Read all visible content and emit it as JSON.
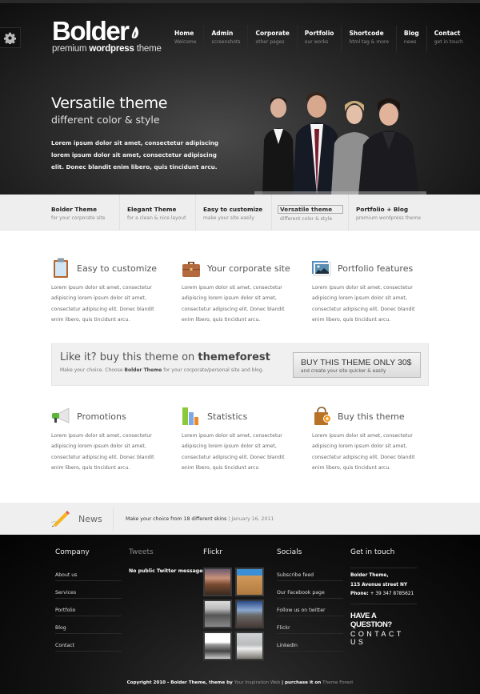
{
  "header": {
    "logo": "Bolder",
    "tagline_prefix": "premium",
    "tagline_bold": "wordpress",
    "tagline_suffix": "theme",
    "nav": [
      {
        "label": "Home",
        "sub": "Welcome"
      },
      {
        "label": "Admin",
        "sub": "screenshots"
      },
      {
        "label": "Corporate",
        "sub": "other pages"
      },
      {
        "label": "Portfolio",
        "sub": "our works"
      },
      {
        "label": "Shortcode",
        "sub": "html tag & more"
      },
      {
        "label": "Blog",
        "sub": "news"
      },
      {
        "label": "Contact",
        "sub": "get in touch"
      }
    ]
  },
  "hero": {
    "title": "Versatile theme",
    "subtitle": "different color & style",
    "text": "Lorem ipsum dolor sit amet, consectetur adipiscing lorem ipsum dolor sit amet, consectetur adipiscing elit. Donec blandit enim libero, quis tincidunt arcu."
  },
  "tabs": [
    {
      "label": "Bolder Theme",
      "sub": "for your corporate site"
    },
    {
      "label": "Elegant Theme",
      "sub": "for a clean & nice layout"
    },
    {
      "label": "Easy to customize",
      "sub": "make your site easily"
    },
    {
      "label": "Versatile theme",
      "sub": "different color & style",
      "active": true
    },
    {
      "label": "Portfolio + Blog",
      "sub": "premium wordpress theme"
    }
  ],
  "features": [
    {
      "icon": "clipboard-icon",
      "title": "Easy to customize",
      "text": "Lorem ipsum dolor sit amet, consectetur adipiscing lorem ipsum dolor sit amet, consectetur adipiscing elit. Donec blandit enim libero, quis tincidunt arcu."
    },
    {
      "icon": "briefcase-icon",
      "title": "Your corporate site",
      "text": "Lorem ipsum dolor sit amet, consectetur adipiscing lorem ipsum dolor sit amet, consectetur adipiscing elit. Donec blandit enim libero, quis tincidunt arcu."
    },
    {
      "icon": "picture-icon",
      "title": "Portfolio features",
      "text": "Lorem ipsum dolor sit amet, consectetur adipiscing lorem ipsum dolor sit amet, consectetur adipiscing elit. Donec blandit enim libero, quis tincidunt arcu."
    },
    {
      "icon": "megaphone-icon",
      "title": "Promotions",
      "text": "Lorem ipsum dolor sit amet, consectetur adipiscing lorem ipsum dolor sit amet, consectetur adipiscing elit. Donec blandit enim libero, quis tincidunt arcu."
    },
    {
      "icon": "bar-chart-icon",
      "title": "Statistics",
      "text": "Lorem ipsum dolor sit amet, consectetur adipiscing lorem ipsum dolor sit amet, consectetur adipiscing elit. Donec blandit enim libero, quis tincidunt arcu"
    },
    {
      "icon": "shopping-bag-icon",
      "title": "Buy this theme",
      "text": "Lorem ipsum dolor sit amet, consectetur adipiscing lorem ipsum dolor sit amet, consectetur adipiscing elit. Donec blandit enim libero, quis tincidunt arcu."
    }
  ],
  "buy": {
    "title_prefix": "Like it? buy this theme on ",
    "title_bold": "themeforest",
    "text_prefix": "Make your choice. Choose ",
    "text_bold": "Bolder Theme",
    "text_suffix": " for your corporate/personal site and blog.",
    "button_label": "BUY THIS THEME ONLY 30$",
    "button_sub": "and create your site quicker & easily"
  },
  "news": {
    "title": "News",
    "text": "Make your choice from 18 different skins",
    "separator": " | ",
    "date": "January 16, 2011"
  },
  "footer": {
    "company": {
      "title": "Company",
      "links": [
        "About us",
        "Services",
        "Portfolio",
        "Blog",
        "Contact"
      ]
    },
    "tweets": {
      "title": "Tweets",
      "text": "No public Twitter messages."
    },
    "flickr": {
      "title": "Flickr",
      "thumbs": [
        "sunset-shore",
        "beach-sand",
        "pier-bw",
        "lake-sky",
        "snow-shore-bw",
        "surf-foam"
      ]
    },
    "socials": {
      "title": "Socials",
      "links": [
        "Subscribe feed",
        "Our Facebook page",
        "Follow us on twitter",
        "Flickr",
        "LinkedIn"
      ]
    },
    "contact": {
      "title": "Get in touch",
      "name": "Bolder Theme,",
      "address": "115 Avenue street NY",
      "phone_label": "Phone:",
      "phone": " + 39 347 8785621",
      "question": "HAVE A QUESTION?",
      "cta": "CONTACT US"
    },
    "copyright": {
      "prefix": "Copyright 2010 - Bolder Theme, theme by ",
      "author": "Your Inspiration Web",
      "middle": " | purchase it on ",
      "store": "Theme Forest"
    }
  }
}
